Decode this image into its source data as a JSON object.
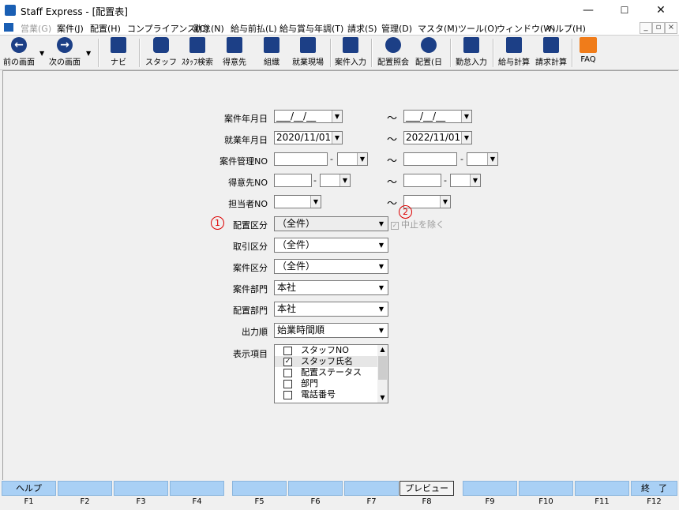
{
  "window": {
    "title": "Staff Express - [配置表]",
    "minimize": "—",
    "maximize": "☐",
    "close": "✕"
  },
  "menu": [
    "営業(G)",
    "案件(J)",
    "配置(H)",
    "コンプライアンス(C)",
    "勤怠(N)",
    "給与前払(L)",
    "給与賞与年調(T)",
    "請求(S)",
    "管理(D)",
    "マスタ(M)",
    "ツール(O)",
    "ウィンドウ(W)",
    "ヘルプ(H)"
  ],
  "toolbar": {
    "prev": "前の画面",
    "next": "次の画面",
    "nav": "ナビ",
    "staff": "スタッフ",
    "staff_search": "ｽﾀｯﾌ検索",
    "client": "得意先",
    "org": "組織",
    "site": "就業現場",
    "case_entry": "案件入力",
    "assign_ref": "配置照会",
    "assign_day": "配置(日",
    "attendance": "勤怠入力",
    "pay_calc": "給与計算",
    "bill_calc": "請求計算",
    "faq": "FAQ"
  },
  "form": {
    "case_date": {
      "label": "案件年月日",
      "from": "___/__/__",
      "to": "___/__/__"
    },
    "work_date": {
      "label": "就業年月日",
      "from": "2020/11/01",
      "to": "2022/11/01"
    },
    "case_no": {
      "label": "案件管理NO"
    },
    "client_no": {
      "label": "得意先NO"
    },
    "person_no": {
      "label": "担当者NO"
    },
    "tilde": "～",
    "dash": "-",
    "assign_class": {
      "label": "配置区分",
      "value": "（全件）",
      "num": "1"
    },
    "exclude_stop": {
      "label": "中止を除く",
      "num": "2"
    },
    "trade_class": {
      "label": "取引区分",
      "value": "（全件）"
    },
    "case_class": {
      "label": "案件区分",
      "value": "（全件）"
    },
    "case_dept": {
      "label": "案件部門",
      "value": "本社"
    },
    "assign_dept": {
      "label": "配置部門",
      "value": "本社"
    },
    "output_order": {
      "label": "出力順",
      "value": "始業時間順"
    },
    "display_items": {
      "label": "表示項目",
      "items": [
        {
          "label": "スタッフNO",
          "checked": false
        },
        {
          "label": "スタッフ氏名",
          "checked": true
        },
        {
          "label": "配置ステータス",
          "checked": false
        },
        {
          "label": "部門",
          "checked": false
        },
        {
          "label": "電話番号",
          "checked": false
        }
      ]
    }
  },
  "fkeys": [
    {
      "label": "ヘルプ",
      "key": "F1"
    },
    {
      "label": "",
      "key": "F2"
    },
    {
      "label": "",
      "key": "F3"
    },
    {
      "label": "",
      "key": "F4"
    },
    {
      "label": "",
      "key": "F5"
    },
    {
      "label": "",
      "key": "F6"
    },
    {
      "label": "",
      "key": "F7"
    },
    {
      "label": "プレビュー",
      "key": "F8"
    },
    {
      "label": "",
      "key": "F9"
    },
    {
      "label": "",
      "key": "F10"
    },
    {
      "label": "",
      "key": "F11"
    },
    {
      "label": "終　了",
      "key": "F12"
    }
  ]
}
